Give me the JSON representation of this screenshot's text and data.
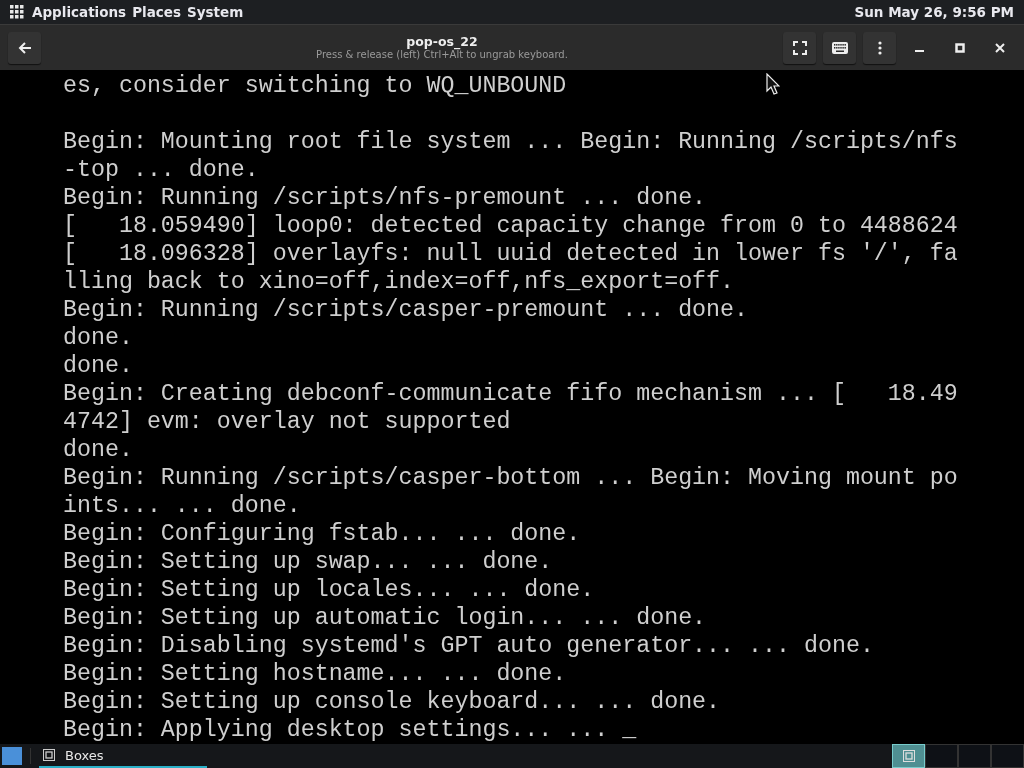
{
  "top_panel": {
    "menus": [
      "Applications",
      "Places",
      "System"
    ],
    "clock": "Sun May 26,  9:56 PM"
  },
  "window": {
    "title": "pop-os_22",
    "subtitle": "Press & release (left) Ctrl+Alt to ungrab keyboard."
  },
  "console": {
    "paragraphs": [
      {
        "lines": [
          "es, consider switching to WQ_UNBOUND"
        ]
      },
      {
        "lines": [
          "Begin: Mounting root file system ... Begin: Running /scripts/nfs",
          "-top ... done.",
          "Begin: Running /scripts/nfs-premount ... done.",
          "[   18.059490] loop0: detected capacity change from 0 to 4488624",
          "[   18.096328] overlayfs: null uuid detected in lower fs '/', fa",
          "lling back to xino=off,index=off,nfs_export=off.",
          "Begin: Running /scripts/casper-premount ... done.",
          "done.",
          "done.",
          "Begin: Creating debconf-communicate fifo mechanism ... [   18.49",
          "4742] evm: overlay not supported",
          "done.",
          "Begin: Running /scripts/casper-bottom ... Begin: Moving mount po",
          "ints... ... done.",
          "Begin: Configuring fstab... ... done.",
          "Begin: Setting up swap... ... done.",
          "Begin: Setting up locales... ... done.",
          "Begin: Setting up automatic login... ... done.",
          "Begin: Disabling systemd's GPT auto generator... ... done.",
          "Begin: Setting hostname... ... done.",
          "Begin: Setting up console keyboard... ... done.",
          "Begin: Applying desktop settings... ... _"
        ]
      }
    ]
  },
  "taskbar": {
    "windows": [
      {
        "label": "Boxes",
        "selected": true
      }
    ],
    "workspaces": [
      {
        "selected": true,
        "has_window": true
      },
      {
        "selected": false,
        "has_window": false
      },
      {
        "selected": false,
        "has_window": false
      },
      {
        "selected": false,
        "has_window": false
      }
    ]
  }
}
